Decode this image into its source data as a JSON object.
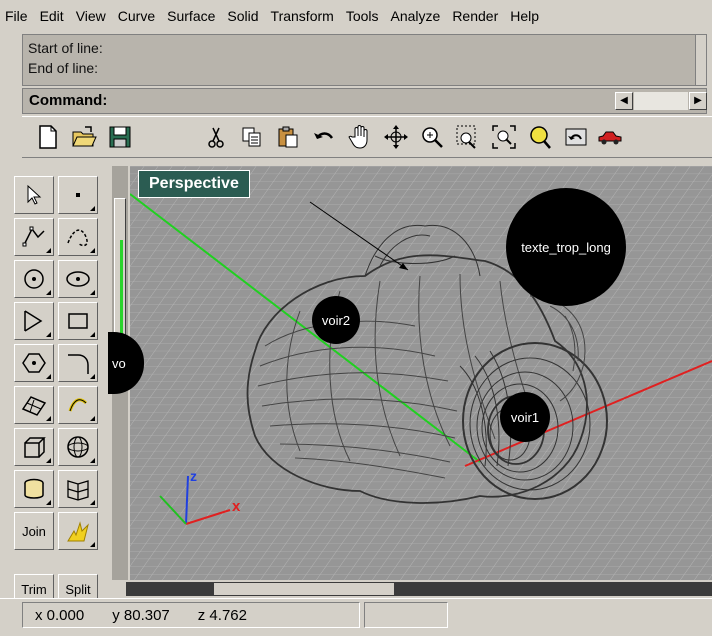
{
  "menu": [
    "File",
    "Edit",
    "View",
    "Curve",
    "Surface",
    "Solid",
    "Transform",
    "Tools",
    "Analyze",
    "Render",
    "Help"
  ],
  "history": {
    "line1": "Start of line:",
    "line2": "End of line:"
  },
  "command": {
    "label": "Command:"
  },
  "viewport": {
    "title": "Perspective",
    "annotations": {
      "large": "texte_trop_long",
      "left": "voir2",
      "right": "voir1",
      "edge": "vo"
    },
    "axis": {
      "x": "x",
      "z": "z"
    }
  },
  "palette": {
    "join": "Join",
    "trim": "Trim",
    "split": "Split"
  },
  "status": {
    "x": "x  0.000",
    "y": "y  80.307",
    "z": "z  4.762"
  },
  "icons": [
    "new-document-icon",
    "open-folder-icon",
    "save-icon",
    "cut-icon",
    "copy-icon",
    "paste-icon",
    "undo-icon",
    "pan-hand-icon",
    "rotate-view-icon",
    "zoom-icon",
    "zoom-window-icon",
    "zoom-extents-icon",
    "zoom-selected-icon",
    "undo-view-icon",
    "car-render-icon"
  ],
  "colors": {
    "viewport_title_bg": "#2b5c52",
    "x_axis": "#e02020",
    "y_axis": "#20c020",
    "z_axis": "#2040e0",
    "wire": "#333333"
  }
}
